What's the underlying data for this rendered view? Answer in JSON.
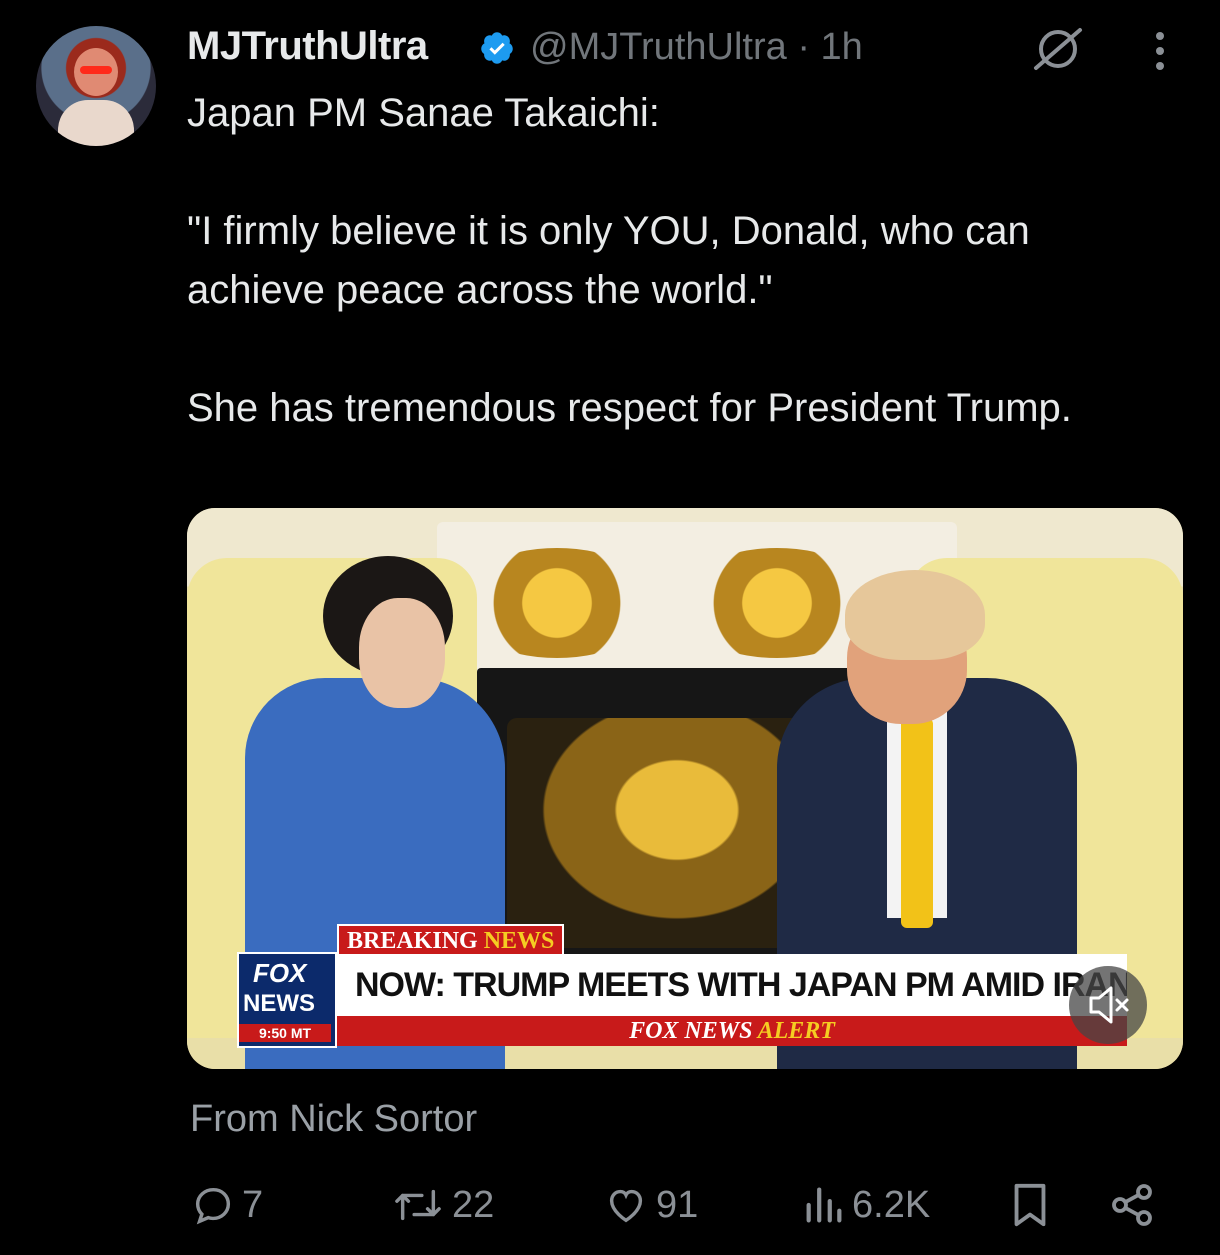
{
  "author": {
    "display_name": "MJTruthUltra",
    "handle": "@MJTruthUltra",
    "separator": "·",
    "time": "1h",
    "verified_color": "#1d9bf0"
  },
  "tweet": {
    "paragraphs": [
      "Japan PM Sanae Takaichi:",
      "\"I firmly believe it is only YOU, Donald, who can achieve peace across the world.\"",
      "She has tremendous respect for President Trump."
    ]
  },
  "media": {
    "breaking_label_1": "BREAKING ",
    "breaking_label_2": "NEWS",
    "headline": "NOW: TRUMP MEETS WITH JAPAN PM AMID IRAN CONFLICT",
    "alert_1": "FOX NEWS ",
    "alert_2": "ALERT",
    "logo_line1": "FOX",
    "logo_line2": "NEWS",
    "time": "9:50 MT"
  },
  "attribution": "From Nick Sortor",
  "actions": {
    "replies": "7",
    "reposts": "22",
    "likes": "91",
    "views": "6.2K"
  },
  "icons": [
    "verified-badge-icon",
    "grok-icon",
    "more-icon",
    "mute-icon",
    "reply-icon",
    "repost-icon",
    "like-icon",
    "views-icon",
    "bookmark-icon",
    "share-icon"
  ]
}
